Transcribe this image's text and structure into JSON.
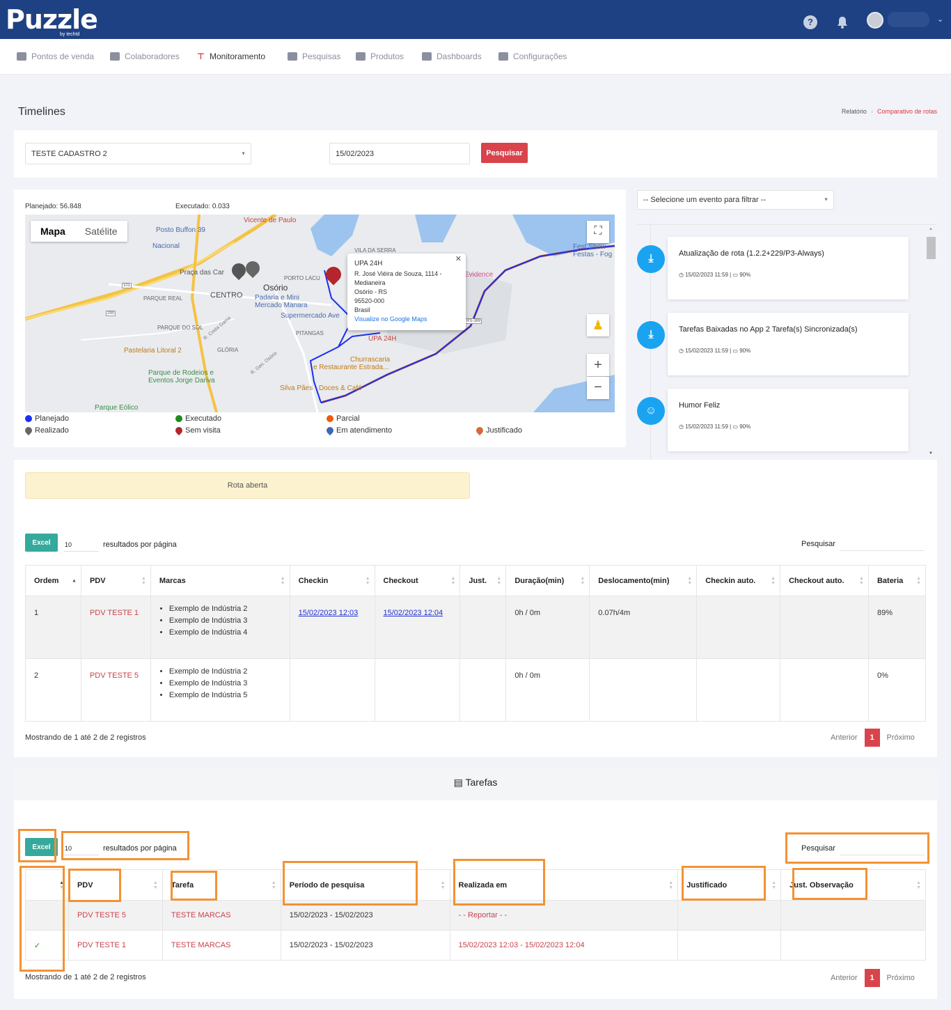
{
  "header": {
    "logo": "Puzzle",
    "logo_sub": "by techtd",
    "help_icon": "?"
  },
  "nav": {
    "items": [
      {
        "label": "Pontos de venda",
        "icon": "store-icon"
      },
      {
        "label": "Colaboradores",
        "icon": "users-icon"
      },
      {
        "label": "Monitoramento",
        "icon": "monitor-icon"
      },
      {
        "label": "Pesquisas",
        "icon": "survey-icon"
      },
      {
        "label": "Produtos",
        "icon": "barcode-icon"
      },
      {
        "label": "Dashboards",
        "icon": "chart-icon"
      },
      {
        "label": "Configurações",
        "icon": "gear-icon"
      }
    ]
  },
  "page": {
    "title": "Timelines",
    "breadcrumb_1": "Relatório",
    "breadcrumb_2": "Comparativo de rotas"
  },
  "filters": {
    "collaborator": "TESTE CADASTRO 2",
    "date": "15/02/2023",
    "search_button": "Pesquisar"
  },
  "route": {
    "planned": "Planejado: 56.848",
    "executed": "Executado: 0.033"
  },
  "map": {
    "tab_map": "Mapa",
    "tab_satellite": "Satélite",
    "popup_title": "UPA 24H",
    "popup_line1": "R. José Vièira de Souza, 1114 -",
    "popup_line2": "Medianeira",
    "popup_line3": "Osório - RS",
    "popup_line4": "95520-000",
    "popup_line5": "Brasil",
    "popup_link": "Visualize no Google Maps",
    "labels": {
      "l1": "Posto Buffon 39",
      "l2": "Nacional",
      "l3": "Vicente de Paulo",
      "l4": "Praça das Car",
      "l5": "Osório",
      "l6": "CENTRO",
      "l7": "PARQUE REAL",
      "l8": "Padaria e Mini",
      "l9": "Mercado Manara",
      "l10": "Supermercado Ave",
      "l11": "PARQUE DO SOL",
      "l12": "PITANGAS",
      "l13": "Pastelaria Litoral 2",
      "l14": "GLÓRIA",
      "l15": "UPA 24H",
      "l16": "Churrascaria",
      "l17": "e Restaurante Estrada...",
      "l18": "Parque de Rodeios e",
      "l19": "Eventos Jorge Dariva",
      "l20": "Silva Pães",
      "l21": "Doces & Café",
      "l22": "Parque Eólico",
      "l23": "VILA DA SERRA",
      "l24": "PORTO LACU",
      "l25": "Evidence",
      "l26": "Fest Show",
      "l27": "Festas - Fog",
      "l28": "RS-389",
      "l29": "101",
      "l30": "290",
      "l31": "R. Costa Gama",
      "l32": "R. Gen. Osório"
    }
  },
  "legend": {
    "planned": "Planejado",
    "executed": "Executado",
    "partial": "Parcial",
    "done": "Realizado",
    "no_visit": "Sem visita",
    "in_service": "Em atendimento",
    "justified": "Justificado"
  },
  "timeline": {
    "filter_placeholder": "-- Selecione um evento para filtrar --",
    "events": [
      {
        "title": "Atualização de rota (1.2.2+229/P3-Always)",
        "time": "15/02/2023 11:59",
        "battery": "90%"
      },
      {
        "title": "Tarefas Baixadas no App 2 Tarefa(s) Sincronizada(s)",
        "time": "15/02/2023 11:59",
        "battery": "90%"
      },
      {
        "title": "Humor Feliz",
        "time": "15/02/2023 11:59",
        "battery": "90%"
      }
    ]
  },
  "alert": "Rota aberta",
  "visits_table": {
    "excel": "Excel",
    "per_page_value": "10",
    "per_page_label": "resultados por página",
    "search_label": "Pesquisar",
    "headers": [
      "Ordem",
      "PDV",
      "Marcas",
      "Checkin",
      "Checkout",
      "Just.",
      "Duração(min)",
      "Deslocamento(min)",
      "Checkin auto.",
      "Checkout auto.",
      "Bateria"
    ],
    "rows": [
      {
        "ordem": "1",
        "pdv": "PDV TESTE 1",
        "marcas": [
          "Exemplo de Indústria 2",
          "Exemplo de Indústria 3",
          "Exemplo de Indústria 4"
        ],
        "checkin": "15/02/2023 12:03",
        "checkout": "15/02/2023 12:04",
        "just": "",
        "duracao": "0h / 0m",
        "desloc": "0.07h/4m",
        "ci_auto": "",
        "co_auto": "",
        "bateria": "89%"
      },
      {
        "ordem": "2",
        "pdv": "PDV TESTE 5",
        "marcas": [
          "Exemplo de Indústria 2",
          "Exemplo de Indústria 3",
          "Exemplo de Indústria 5"
        ],
        "checkin": "",
        "checkout": "",
        "just": "",
        "duracao": "0h / 0m",
        "desloc": "",
        "ci_auto": "",
        "co_auto": "",
        "bateria": "0%"
      }
    ],
    "showing": "Mostrando de 1 até 2 de 2 registros",
    "prev": "Anterior",
    "page": "1",
    "next": "Próximo"
  },
  "tasks": {
    "title": "Tarefas",
    "excel": "Excel",
    "per_page_value": "10",
    "per_page_label": "resultados por página",
    "search_label": "Pesquisar",
    "headers": [
      "",
      "PDV",
      "Tarefa",
      "Período de pesquisa",
      "Realizada em",
      "Justificado",
      "Just. Observação"
    ],
    "rows": [
      {
        "check": "",
        "pdv": "PDV TESTE 5",
        "tarefa": "TESTE MARCAS",
        "periodo": "15/02/2023 - 15/02/2023",
        "realizada": "- - Reportar - -",
        "justificado": "",
        "obs": ""
      },
      {
        "check": "✓",
        "pdv": "PDV TESTE 1",
        "tarefa": "TESTE MARCAS",
        "periodo": "15/02/2023 - 15/02/2023",
        "realizada": "15/02/2023 12:03 - 15/02/2023 12:04",
        "justificado": "",
        "obs": ""
      }
    ],
    "showing": "Mostrando de 1 até 2 de 2 registros",
    "prev": "Anterior",
    "page": "1",
    "next": "Próximo"
  },
  "colors": {
    "header_blue": "#1d4183",
    "accent_red": "#d9434b",
    "excel_teal": "#35a99c",
    "route_blue": "#1a2ff0",
    "highlight_orange": "#f39234",
    "timeline_blue": "#1aa3f0"
  }
}
